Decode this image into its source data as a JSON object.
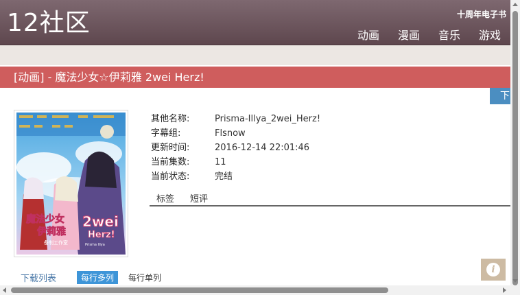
{
  "header": {
    "logo": "12社区",
    "top_link": "十周年电子书",
    "nav": [
      "动画",
      "漫画",
      "音乐",
      "游戏"
    ]
  },
  "title_bar": "[动画] - 魔法少女☆伊莉雅 2wei Herz!",
  "download_tab": "下",
  "info": {
    "rows": [
      {
        "label": "其他名称:",
        "value": "Prisma-Illya_2wei_Herz!"
      },
      {
        "label": "字幕组:",
        "value": "Flsnow"
      },
      {
        "label": "更新时间:",
        "value": "2016-12-14 22:01:46"
      },
      {
        "label": "当前集数:",
        "value": "11"
      },
      {
        "label": "当前状态:",
        "value": "完结"
      }
    ]
  },
  "tabs": [
    "标签",
    "短评"
  ],
  "list": {
    "title": "下载列表",
    "mode_active": "每行多列",
    "mode_other": "每行单列"
  },
  "poster": {
    "title_line1": "魔法少女",
    "title_line2": "伊莉雅",
    "title_badge": "2wei",
    "title_badge2": "Herz!",
    "subtitle": "备制工作室",
    "credit": "Prisma Illya"
  },
  "colors": {
    "header": "#6b545b",
    "title_bar": "#cf5d5d",
    "accent_blue": "#3e95d8",
    "info_button": "#cdbba3"
  }
}
